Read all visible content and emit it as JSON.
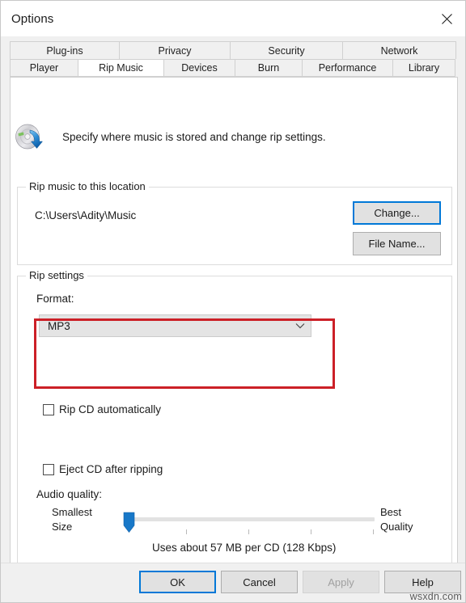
{
  "window": {
    "title": "Options",
    "close_icon": "close-icon"
  },
  "tabs": {
    "row1": [
      {
        "label": "Plug-ins",
        "active": false
      },
      {
        "label": "Privacy",
        "active": false
      },
      {
        "label": "Security",
        "active": false
      },
      {
        "label": "Network",
        "active": false
      }
    ],
    "row2": [
      {
        "label": "Player",
        "active": false
      },
      {
        "label": "Rip Music",
        "active": true
      },
      {
        "label": "Devices",
        "active": false
      },
      {
        "label": "Burn",
        "active": false
      },
      {
        "label": "Performance",
        "active": false
      },
      {
        "label": "Library",
        "active": false
      }
    ]
  },
  "header": {
    "icon": "cd-rip-icon",
    "description": "Specify where music is stored and change rip settings."
  },
  "rip_location": {
    "legend": "Rip music to this location",
    "path": "C:\\Users\\Adity\\Music",
    "change_button": "Change...",
    "file_name_button": "File Name..."
  },
  "rip_settings": {
    "legend": "Rip settings",
    "format_label": "Format:",
    "format_value": "MP3",
    "format_dropdown_icon": "chevron-down-icon",
    "highlight_color": "#cc2027",
    "rip_cd_automatically": {
      "label": "Rip CD automatically",
      "checked": false
    },
    "eject_cd_after_ripping": {
      "label": "Eject CD after ripping",
      "checked": false
    },
    "audio_quality": {
      "label": "Audio quality:",
      "min_label_line1": "Smallest",
      "min_label_line2": "Size",
      "max_label_line1": "Best",
      "max_label_line2": "Quality",
      "slider_position_percent": 0,
      "tick_count": 4,
      "note": "Uses about 57 MB per CD (128 Kbps)"
    }
  },
  "footer": {
    "ok": "OK",
    "cancel": "Cancel",
    "apply": "Apply",
    "apply_disabled": true,
    "help": "Help"
  },
  "watermark": "wsxdn.com"
}
